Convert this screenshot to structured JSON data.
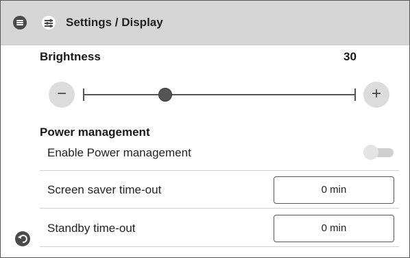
{
  "header": {
    "title": "Settings / Display",
    "menu_icon": "menu-icon",
    "settings_icon": "sliders-icon"
  },
  "brightness": {
    "label": "Brightness",
    "value": "30",
    "decrease_symbol": "−",
    "increase_symbol": "+",
    "slider_fraction": 0.3
  },
  "power": {
    "section_label": "Power management",
    "enable_label": "Enable Power management",
    "enable_on": false,
    "screen_saver_label": "Screen saver time-out",
    "screen_saver_value": "0 min",
    "standby_label": "Standby time-out",
    "standby_value": "0 min"
  },
  "footer": {
    "back_icon": "back-icon"
  }
}
